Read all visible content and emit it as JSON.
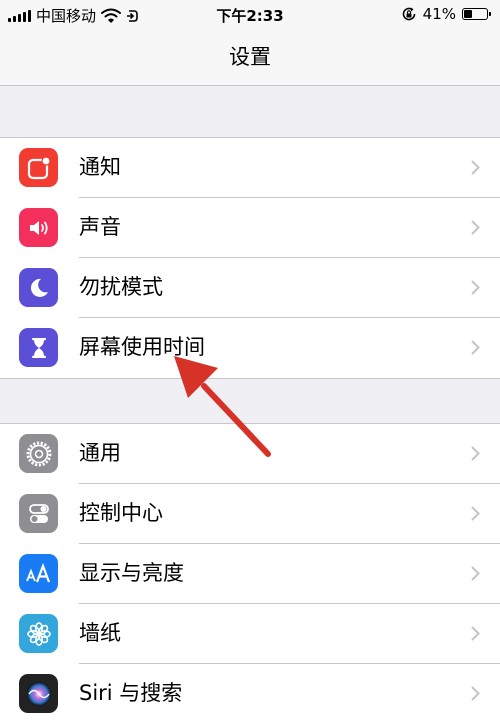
{
  "status_bar": {
    "carrier": "中国移动",
    "time": "下午2:33",
    "battery_percent": "41%",
    "battery_level": 0.41
  },
  "nav": {
    "title": "设置"
  },
  "groups": [
    {
      "items": [
        {
          "label": "通知",
          "icon": "notifications-icon",
          "color": "#f23c32"
        },
        {
          "label": "声音",
          "icon": "sound-icon",
          "color": "#f2305b"
        },
        {
          "label": "勿扰模式",
          "icon": "moon-icon",
          "color": "#5a4fd6"
        },
        {
          "label": "屏幕使用时间",
          "icon": "hourglass-icon",
          "color": "#5a4fd6"
        }
      ]
    },
    {
      "items": [
        {
          "label": "通用",
          "icon": "gear-icon",
          "color": "#8e8e93"
        },
        {
          "label": "控制中心",
          "icon": "toggles-icon",
          "color": "#8e8e93"
        },
        {
          "label": "显示与亮度",
          "icon": "text-size-icon",
          "color": "#1a7cf5"
        },
        {
          "label": "墙纸",
          "icon": "wallpaper-flower-icon",
          "color": "#33a6dc"
        },
        {
          "label": "Siri 与搜索",
          "icon": "siri-icon",
          "color": "#222222"
        }
      ]
    }
  ],
  "colors": {
    "annotation_arrow": "#d63227",
    "separator": "#c8c7cc",
    "background": "#efeff4"
  }
}
